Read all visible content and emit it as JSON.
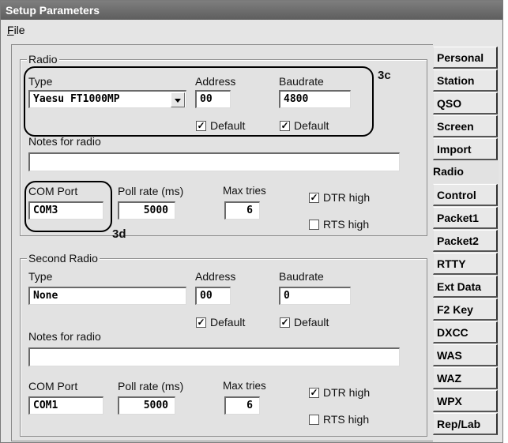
{
  "window": {
    "title": "Setup Parameters"
  },
  "menu": {
    "file": "File"
  },
  "radio": {
    "group_title": "Radio",
    "type_label": "Type",
    "type_value": "Yaesu FT1000MP",
    "address_label": "Address",
    "address_value": "00",
    "baud_label": "Baudrate",
    "baud_value": "4800",
    "default_label": "Default",
    "notes_label": "Notes for radio",
    "notes_value": "",
    "com_label": "COM Port",
    "com_value": "COM3",
    "poll_label": "Poll rate (ms)",
    "poll_value": "5000",
    "tries_label": "Max tries",
    "tries_value": "6",
    "dtr_label": "DTR high",
    "rts_label": "RTS high"
  },
  "radio2": {
    "group_title": "Second Radio",
    "type_label": "Type",
    "type_value": "None",
    "address_label": "Address",
    "address_value": "00",
    "baud_label": "Baudrate",
    "baud_value": "0",
    "default_label": "Default",
    "notes_label": "Notes for radio",
    "notes_value": "",
    "com_label": "COM Port",
    "com_value": "COM1",
    "poll_label": "Poll rate (ms)",
    "poll_value": "5000",
    "tries_label": "Max tries",
    "tries_value": "6",
    "dtr_label": "DTR high",
    "rts_label": "RTS high"
  },
  "checks": {
    "radio_addr_default": true,
    "radio_baud_default": true,
    "radio_dtr": true,
    "radio_rts": false,
    "radio2_addr_default": true,
    "radio2_baud_default": true,
    "radio2_dtr": true,
    "radio2_rts": false
  },
  "annotations": {
    "a": "3c",
    "b": "3d"
  },
  "tabs": [
    "Personal",
    "Station",
    "QSO",
    "Screen",
    "Import",
    "Radio",
    "Control",
    "Packet1",
    "Packet2",
    "RTTY",
    "Ext Data",
    "F2 Key",
    "DXCC",
    "WAS",
    "WAZ",
    "WPX",
    "Rep/Lab"
  ],
  "active_tab": "Radio"
}
